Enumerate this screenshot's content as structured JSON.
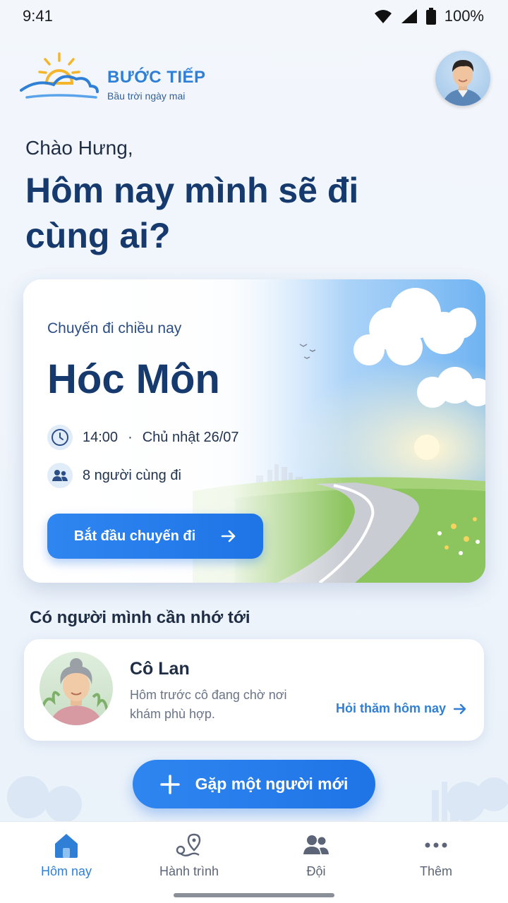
{
  "status_bar": {
    "time": "9:41",
    "battery": "100%",
    "icons": [
      "wifi-icon",
      "signal-icon",
      "battery-icon"
    ]
  },
  "header": {
    "brand_name": "BƯỚC TIẾP",
    "brand_tagline": "Bầu trời ngày mai",
    "logo_icon": "sun-cloud-logo",
    "avatar": "user-avatar"
  },
  "greeting": {
    "hello": "Chào Hưng,",
    "headline": "Hôm nay mình sẽ đi cùng ai?"
  },
  "trip": {
    "label": "Chuyến đi chiều nay",
    "city": "Hóc Môn",
    "time": "14:00",
    "date": "Chủ nhật 26/07",
    "separator": "·",
    "people": "8 người cùng đi",
    "button": "Bắt đầu chuyến đi",
    "icons": [
      "clock-icon",
      "people-icon",
      "arrow-right-icon"
    ]
  },
  "reminder": {
    "section_title": "Có người mình cần nhớ tới",
    "name": "Cô Lan",
    "note": "Hôm trước cô đang chờ nơi khám phù hợp.",
    "link": "Hỏi thăm hôm nay"
  },
  "new_person": {
    "label": "Gặp một người mới",
    "icon": "plus-icon"
  },
  "bottom_nav": {
    "items": [
      {
        "label": "Hôm nay",
        "icon": "home-icon",
        "active": true
      },
      {
        "label": "Hành trình",
        "icon": "route-icon",
        "active": false
      },
      {
        "label": "Đội",
        "icon": "team-icon",
        "active": false
      },
      {
        "label": "Thêm",
        "icon": "more-icon",
        "active": false
      }
    ]
  },
  "colors": {
    "accent": "#2f7fd6",
    "button": "#1f74e6",
    "headline": "#163a6e"
  }
}
